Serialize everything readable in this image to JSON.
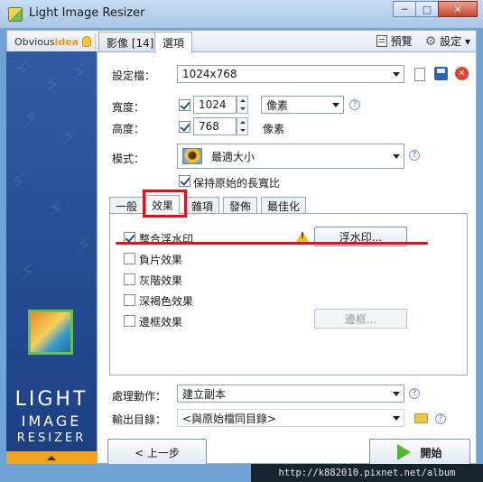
{
  "window": {
    "title": "Light Image Resizer",
    "minimize": "─",
    "maximize": "□",
    "close": "✕"
  },
  "topbar": {
    "logo_prefix": "Obvious",
    "logo_accent": "idea",
    "tabs": [
      {
        "label": "影像 [14]"
      },
      {
        "label": "選項"
      }
    ],
    "preview_label": "預覽",
    "settings_label": "設定 ▾"
  },
  "branding": {
    "line1": "LIGHT",
    "line2": "IMAGE",
    "line3": "RESIZER"
  },
  "form": {
    "profile_label": "設定檔：",
    "profile_value": "1024x768",
    "width_label": "寬度：",
    "width_value": "1024",
    "unit_value": "像素",
    "height_label": "高度：",
    "height_value": "768",
    "height_unit": "像素",
    "mode_label": "模式：",
    "mode_value": "最適大小",
    "keep_ratio_label": "保持原始的長寬比"
  },
  "inner_tabs": [
    {
      "label": "一般"
    },
    {
      "label": "效果"
    },
    {
      "label": "雜項"
    },
    {
      "label": "發佈"
    },
    {
      "label": "最佳化"
    }
  ],
  "effects": [
    {
      "label": "整合浮水印",
      "checked": true
    },
    {
      "label": "負片效果",
      "checked": false
    },
    {
      "label": "灰階效果",
      "checked": false
    },
    {
      "label": "深褐色效果",
      "checked": false
    },
    {
      "label": "邊框效果",
      "checked": false
    }
  ],
  "watermark_button": "浮水印...",
  "border_button": "邊框...",
  "action_label": "處理動作：",
  "action_value": "建立副本",
  "output_label": "輸出目錄：",
  "output_value": "<與原始檔同目錄>",
  "back_button": "< 上一步",
  "start_button": "開始",
  "overlay_watermark": "http://k882010.pixnet.net/album",
  "colors": {
    "highlight": "#e0101e",
    "brand_blue": "#1c3f82",
    "accent_orange": "#f0a21d"
  }
}
